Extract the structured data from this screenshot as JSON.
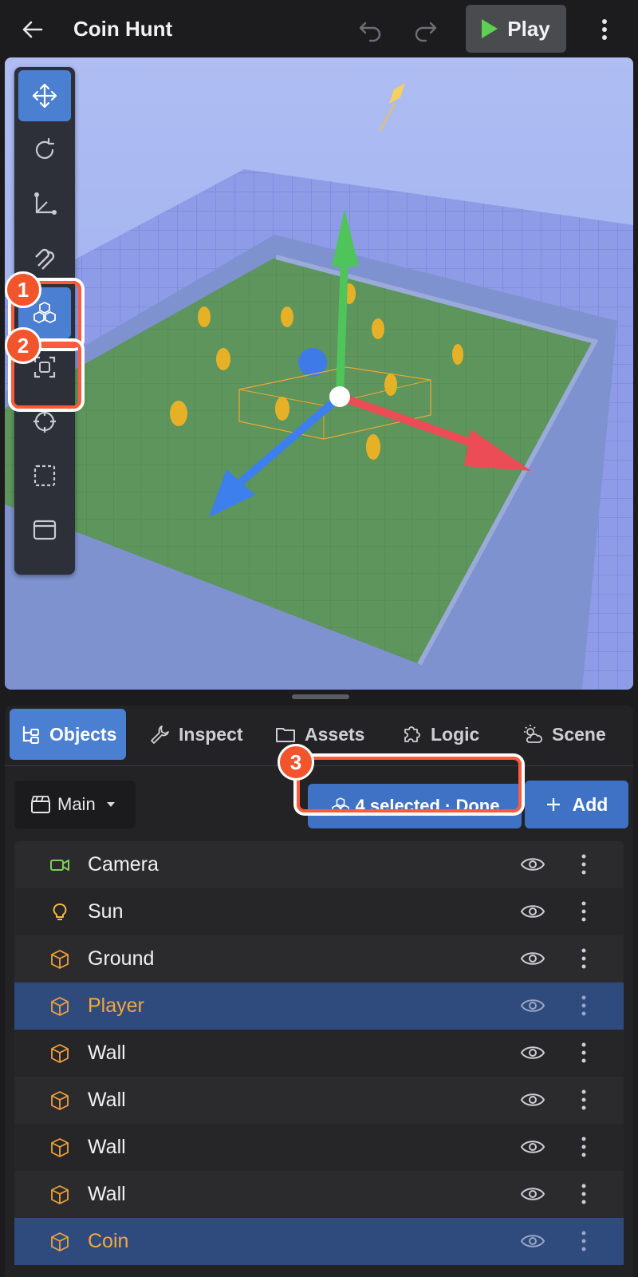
{
  "header": {
    "title": "Coin Hunt",
    "play_label": "Play"
  },
  "colors": {
    "accent": "#4b7fd1",
    "play_green": "#5fcf52",
    "highlight": "#ff5a3c",
    "selected_text": "#f3a83a"
  },
  "toolbar": {
    "tools": [
      {
        "icon": "move-icon",
        "active": true
      },
      {
        "icon": "rotate-icon",
        "active": false
      },
      {
        "icon": "scale-axes-icon",
        "active": false
      },
      {
        "icon": "magnet-icon",
        "active": false
      },
      {
        "icon": "multi-select-icon",
        "active": true
      },
      {
        "icon": "frame-selection-icon",
        "active": false
      },
      {
        "icon": "crosshair-icon",
        "active": false
      },
      {
        "icon": "marquee-select-icon",
        "active": false
      },
      {
        "icon": "window-icon",
        "active": false
      }
    ]
  },
  "annotations": [
    "1",
    "2",
    "3"
  ],
  "tabs": [
    {
      "label": "Objects",
      "icon": "hierarchy-icon",
      "active": true
    },
    {
      "label": "Inspect",
      "icon": "wrench-icon",
      "active": false
    },
    {
      "label": "Assets",
      "icon": "folder-icon",
      "active": false
    },
    {
      "label": "Logic",
      "icon": "puzzle-icon",
      "active": false
    },
    {
      "label": "Scene",
      "icon": "weather-icon",
      "active": false
    }
  ],
  "objects_toolbar": {
    "scene_select": "Main",
    "selection_button": "4 selected · Done",
    "add_button": "Add"
  },
  "objects": [
    {
      "name": "Camera",
      "icon": "camera-icon",
      "selected": false
    },
    {
      "name": "Sun",
      "icon": "lightbulb-icon",
      "selected": false
    },
    {
      "name": "Ground",
      "icon": "cube-icon",
      "selected": false
    },
    {
      "name": "Player",
      "icon": "cube-icon",
      "selected": true
    },
    {
      "name": "Wall",
      "icon": "cube-icon",
      "selected": false
    },
    {
      "name": "Wall",
      "icon": "cube-icon",
      "selected": false
    },
    {
      "name": "Wall",
      "icon": "cube-icon",
      "selected": false
    },
    {
      "name": "Wall",
      "icon": "cube-icon",
      "selected": false
    },
    {
      "name": "Coin",
      "icon": "cube-icon",
      "selected": true
    }
  ]
}
